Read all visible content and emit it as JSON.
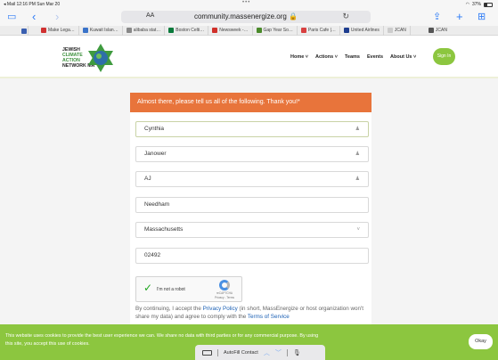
{
  "status_bar": {
    "left": "◂ Mail  12:16 PM  Sun Mar 20",
    "dots": "•••",
    "right": "37%"
  },
  "browser": {
    "text_size_label": "AA",
    "url": "community.massenergize.org 🔒",
    "bookmarks": [
      {
        "label": "Make Lega…",
        "color": "#d03030"
      },
      {
        "label": "Kuwait Islan…",
        "color": "#3a73c9"
      },
      {
        "label": "alibaba stat…",
        "color": "#888888"
      },
      {
        "label": "Boston Celti…",
        "color": "#0a7a3c"
      },
      {
        "label": "Newsweek -…",
        "color": "#d0302a"
      },
      {
        "label": "Gap Year So…",
        "color": "#4a8a2a"
      },
      {
        "label": "Paris Cafe |…",
        "color": "#d84040"
      },
      {
        "label": "United Airlines",
        "color": "#1e3d8f"
      },
      {
        "label": "JCAN",
        "color": "#cccccc"
      },
      {
        "label": "JCAN",
        "color": "#555555"
      }
    ]
  },
  "site": {
    "logo_lines": [
      "JEWISH",
      "CLIMATE",
      "ACTION",
      "NETWORK MA"
    ],
    "nav": [
      "Home ˅",
      "Actions ˅",
      "Teams",
      "Events",
      "About Us ˅"
    ],
    "sign_in": "Sign In"
  },
  "form": {
    "header": "Almost there, please tell us all of the following. Thank you!*",
    "fields": [
      {
        "value": "Cynthia",
        "icon": "person-icon"
      },
      {
        "value": "Janower",
        "icon": "person-icon"
      },
      {
        "value": "AJ",
        "icon": "person-icon"
      },
      {
        "value": "Needham",
        "icon": ""
      },
      {
        "value": "Massachusetts",
        "icon": "dropdown-icon"
      },
      {
        "value": "02492",
        "icon": ""
      }
    ],
    "captcha": {
      "label": "I'm not a robot",
      "brand": "reCAPTCHA",
      "links": "Privacy - Terms"
    },
    "consent_1": "By continuing, I accept the ",
    "privacy_link": "Privacy Policy",
    "consent_2": " (in short, MassEnergize or host organization won't share my data) and agree to comply with the ",
    "terms_link": "Terms of Service"
  },
  "cookie": {
    "message": "This website uses cookies to provide the best user experience we can. We share no data with third parties or for any commercial purpose. By using this site, you accept this use of cookies.",
    "okay": "Okay"
  },
  "keyboard_bar": {
    "autofill": "AutoFill Contact"
  }
}
